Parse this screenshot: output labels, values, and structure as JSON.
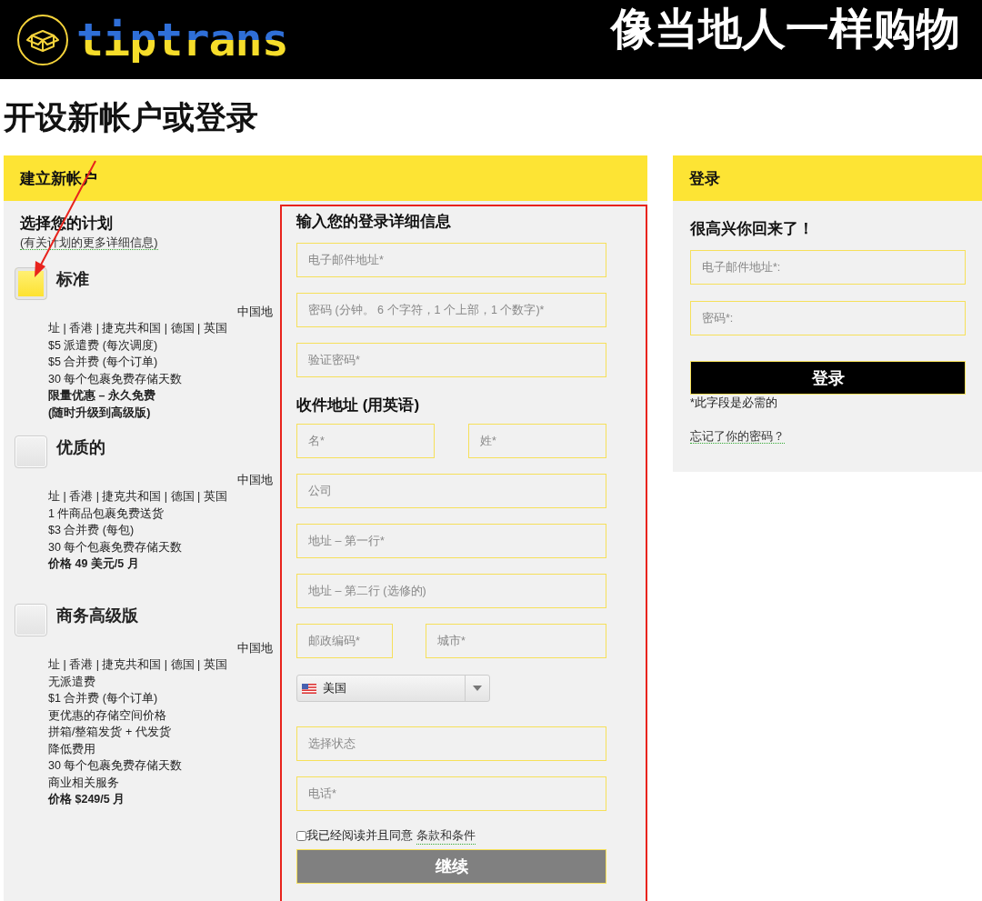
{
  "header": {
    "logo_text": "tiptrans",
    "slogan": "像当地人一样购物"
  },
  "page_title": "开设新帐户或登录",
  "signup": {
    "title": "建立新帐户",
    "plans_heading": "选择您的计划",
    "plans_link": "(有关计划的更多详细信息)",
    "plans": [
      {
        "name": "标准",
        "selected": true,
        "region_start": "中国地",
        "features": [
          {
            "text": "址 | 香港 | 捷克共和国 | 德国 | 英国",
            "bold": false
          },
          {
            "text": "$5 派遣费 (每次调度)",
            "bold": false
          },
          {
            "text": "$5 合并费 (每个订单)",
            "bold": false
          },
          {
            "text": "30 每个包裹免费存储天数",
            "bold": false
          },
          {
            "text": "限量优惠 – 永久免费",
            "bold": true
          },
          {
            "text": "(随时升级到高级版)",
            "bold": true
          }
        ]
      },
      {
        "name": "优质的",
        "selected": false,
        "region_start": "中国地",
        "features": [
          {
            "text": "址 | 香港 | 捷克共和国 | 德国 | 英国",
            "bold": false
          },
          {
            "text": "1 件商品包裹免费送货",
            "bold": false
          },
          {
            "text": "$3 合并费 (每包)",
            "bold": false
          },
          {
            "text": "30 每个包裹免费存储天数",
            "bold": false
          },
          {
            "text": "价格 49 美元/5 月",
            "bold": true
          }
        ]
      },
      {
        "name": "商务高级版",
        "selected": false,
        "region_start": "中国地",
        "features": [
          {
            "text": "址 | 香港 | 捷克共和国 | 德国 | 英国",
            "bold": false
          },
          {
            "text": "无派遣费",
            "bold": false
          },
          {
            "text": "$1 合并费 (每个订单)",
            "bold": false
          },
          {
            "text": "更优惠的存储空间价格",
            "bold": false
          },
          {
            "text": "拼箱/整箱发货 + 代发货",
            "bold": false
          },
          {
            "text": "降低费用",
            "bold": false
          },
          {
            "text": "30 每个包裹免费存储天数",
            "bold": false
          },
          {
            "text": "商业相关服务",
            "bold": false
          },
          {
            "text": "价格 $249/5 月",
            "bold": true
          }
        ]
      }
    ],
    "login_heading": "输入您的登录详细信息",
    "login_fields": [
      {
        "placeholder": "电子邮件地址*"
      },
      {
        "placeholder": "密码 (分钟。 6 个字符，1 个上部，1 个数字)*"
      },
      {
        "placeholder": "验证密码*"
      }
    ],
    "address_heading": "收件地址 (用英语)",
    "address_rows": [
      {
        "kind": "pair",
        "fields": [
          {
            "placeholder": "名*"
          },
          {
            "placeholder": "姓*"
          }
        ]
      },
      {
        "kind": "single",
        "fields": [
          {
            "placeholder": "公司"
          }
        ]
      },
      {
        "kind": "single",
        "fields": [
          {
            "placeholder": "地址 – 第一行*"
          }
        ]
      },
      {
        "kind": "single",
        "fields": [
          {
            "placeholder": "地址 – 第二行 (选修的)"
          }
        ]
      },
      {
        "kind": "zip",
        "fields": [
          {
            "placeholder": "邮政编码*"
          },
          {
            "placeholder": "城市*"
          }
        ]
      },
      {
        "kind": "country",
        "value": "美国"
      },
      {
        "kind": "single",
        "fields": [
          {
            "placeholder": "选择状态"
          }
        ]
      },
      {
        "kind": "single",
        "fields": [
          {
            "placeholder": "电话*"
          }
        ]
      }
    ],
    "terms": {
      "checked": false,
      "text": "我已经阅读并且同意",
      "link": "条款和条件"
    },
    "continue_button": "继续"
  },
  "login": {
    "title": "登录",
    "greeting": "很高兴你回来了！",
    "fields": [
      {
        "placeholder": "电子邮件地址*:"
      },
      {
        "placeholder": "密码*:"
      }
    ],
    "button": "登录",
    "note": "*此字段是必需的",
    "forgot_link": "忘记了你的密码？"
  }
}
